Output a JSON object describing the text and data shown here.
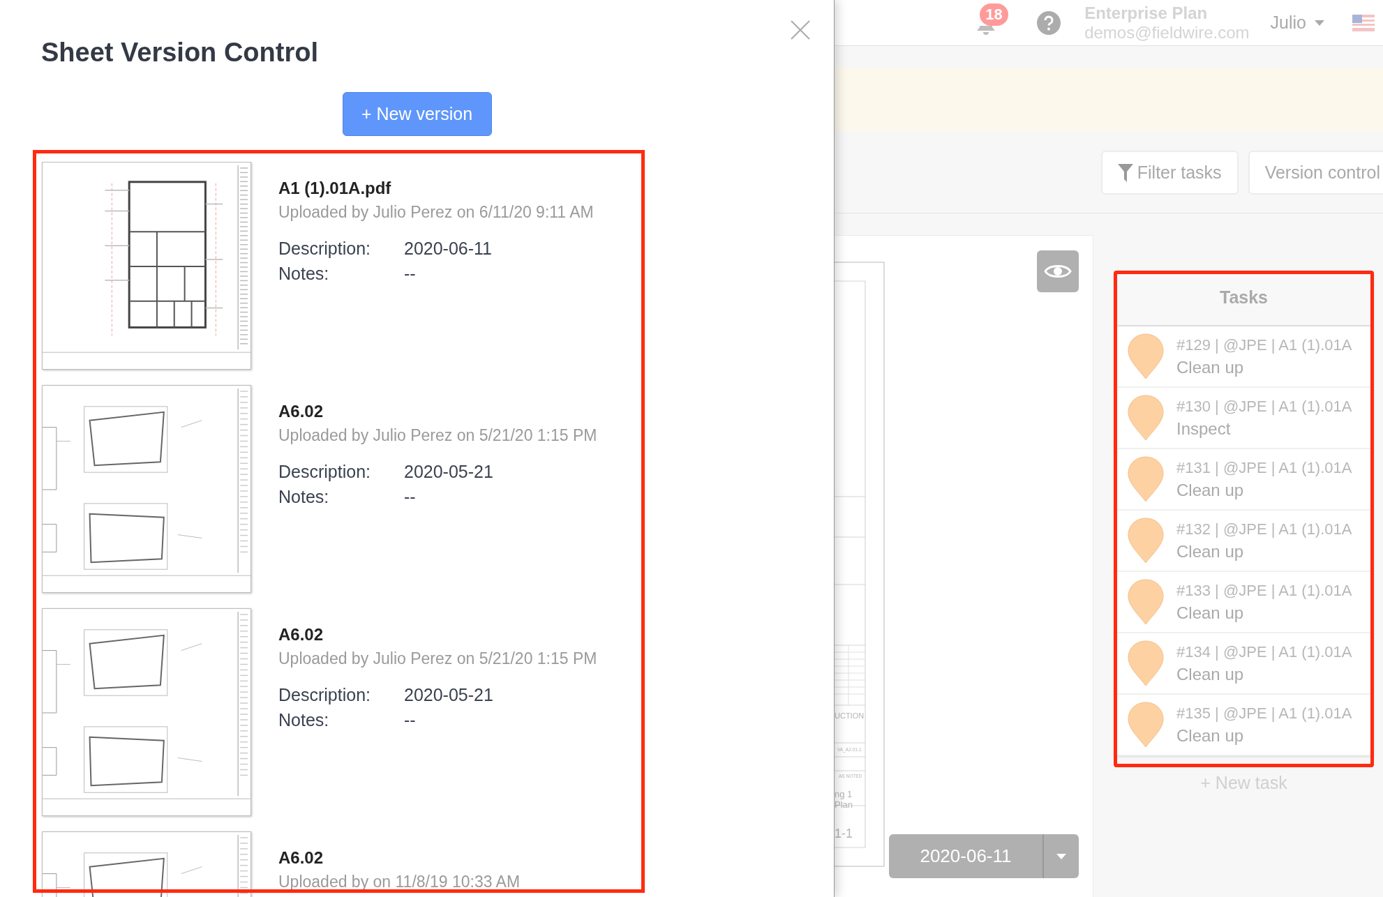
{
  "dialog": {
    "title": "Sheet Version Control",
    "new_version_button": "+ New version",
    "versions": [
      {
        "kind": "floor_plan",
        "name": "A1 (1).01A.pdf",
        "uploaded": "Uploaded by Julio Perez on 6/11/20 9:11 AM",
        "description_label": "Description:",
        "description": "2020-06-11",
        "notes_label": "Notes:",
        "notes": "--"
      },
      {
        "kind": "detail",
        "name": "A6.02",
        "uploaded": "Uploaded by Julio Perez on 5/21/20 1:15 PM",
        "description_label": "Description:",
        "description": "2020-05-21",
        "notes_label": "Notes:",
        "notes": "--"
      },
      {
        "kind": "detail",
        "name": "A6.02",
        "uploaded": "Uploaded by Julio Perez on 5/21/20 1:15 PM",
        "description_label": "Description:",
        "description": "2020-05-21",
        "notes_label": "Notes:",
        "notes": "--"
      },
      {
        "kind": "detail",
        "name": "A6.02",
        "uploaded": "Uploaded by on 11/8/19 10:33 AM"
      }
    ]
  },
  "header": {
    "notification_count": "18",
    "plan": "Enterprise Plan",
    "email": "demos@fieldwire.com",
    "user": "Julio"
  },
  "toolbar": {
    "buttons": [
      "Filter tasks",
      "Version control"
    ]
  },
  "sheet": {
    "labels": [
      "UCTION",
      "VA_A2.01-1",
      "AS NOTED",
      "ng 1",
      "Plan",
      "1-1"
    ],
    "date_selector": "2020-06-11"
  },
  "tasks": {
    "title": "Tasks",
    "items": [
      {
        "meta": "#129 | @JPE | A1 (1).01A",
        "title": "Clean up"
      },
      {
        "meta": "#130 | @JPE | A1 (1).01A",
        "title": "Inspect"
      },
      {
        "meta": "#131 | @JPE | A1 (1).01A",
        "title": "Clean up"
      },
      {
        "meta": "#132 | @JPE | A1 (1).01A",
        "title": "Clean up"
      },
      {
        "meta": "#133 | @JPE | A1 (1).01A",
        "title": "Clean up"
      },
      {
        "meta": "#134 | @JPE | A1 (1).01A",
        "title": "Clean up"
      },
      {
        "meta": "#135 | @JPE | A1 (1).01A",
        "title": "Clean up"
      }
    ],
    "new_task": "+ New task"
  }
}
